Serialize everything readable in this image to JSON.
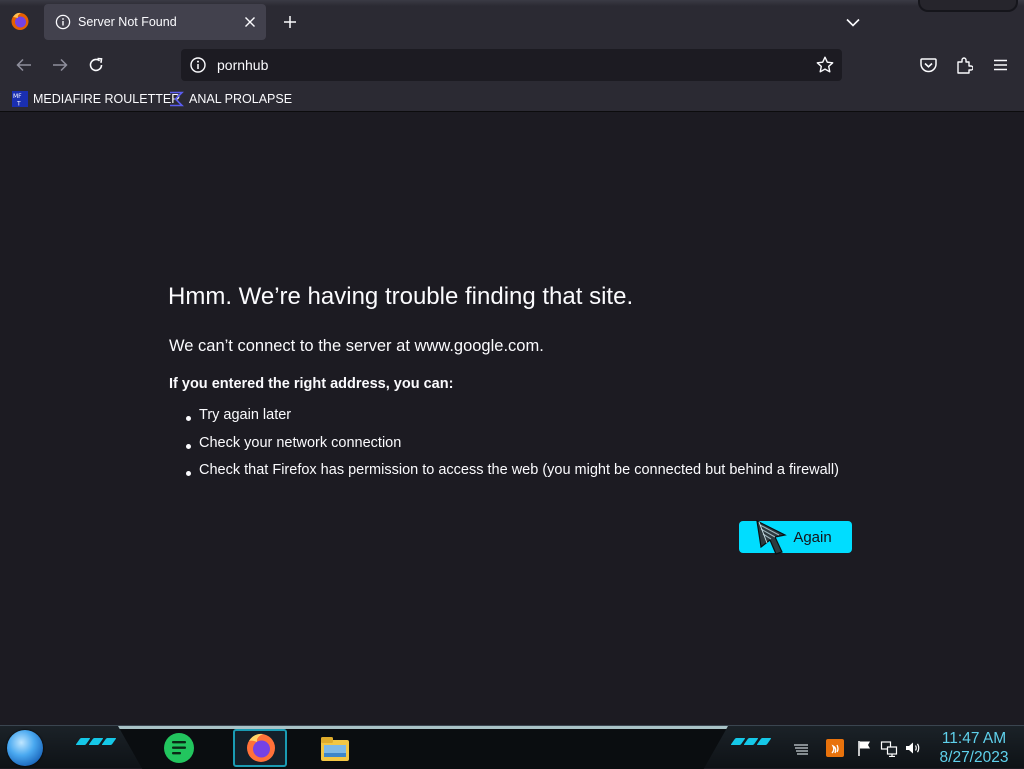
{
  "browser": {
    "tab": {
      "title": "Server Not Found"
    },
    "urlbar": {
      "value": "pornhub"
    },
    "bookmarks": [
      {
        "label": "MEDIAFIRE ROULETTER",
        "icon": "mediafire-icon"
      },
      {
        "label": "ANAL PROLAPSE",
        "icon": "sigma-icon"
      }
    ]
  },
  "error_page": {
    "title": "Hmm. We’re having trouble finding that site.",
    "short_desc": "We can’t connect to the server at www.google.com.",
    "advice_heading": "If you entered the right address, you can:",
    "suggestions": [
      "Try again later",
      "Check your network connection",
      "Check that Firefox has permission to access the web (you might be connected but behind a firewall)"
    ],
    "try_again_label": "Again",
    "accent_color": "#00ddff"
  },
  "taskbar": {
    "clock": {
      "time": "11:47 AM",
      "date": "8/27/2023"
    },
    "apps": [
      "chat-app-icon",
      "firefox-icon",
      "file-explorer-icon"
    ],
    "tray": [
      "stacked-lines-icon",
      "java-icon",
      "flag-icon",
      "network-icon",
      "volume-icon"
    ]
  }
}
